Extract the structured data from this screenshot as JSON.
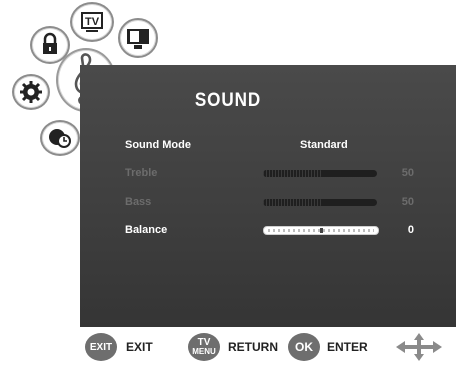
{
  "menu": {
    "title": "SOUND",
    "icons": [
      "lock-icon",
      "tv-icon",
      "monitor-icon",
      "settings-icon",
      "music-clef-icon",
      "clock-icon"
    ],
    "tv_icon_text": "TV"
  },
  "settings": [
    {
      "label": "Sound Mode",
      "value": "Standard",
      "state": "active"
    },
    {
      "label": "Treble",
      "value": "50",
      "level": 0.5,
      "state": "disabled"
    },
    {
      "label": "Bass",
      "value": "50",
      "level": 0.5,
      "state": "disabled"
    },
    {
      "label": "Balance",
      "value": "0",
      "level": 0.5,
      "state": "selected"
    }
  ],
  "footer": {
    "exit_key": "EXIT",
    "exit_label": "EXIT",
    "menu_key_top": "TV",
    "menu_key_bottom": "MENU",
    "return_label": "RETURN",
    "ok_key": "OK",
    "enter_label": "ENTER",
    "nav_icon": "four-way-arrow-icon"
  }
}
